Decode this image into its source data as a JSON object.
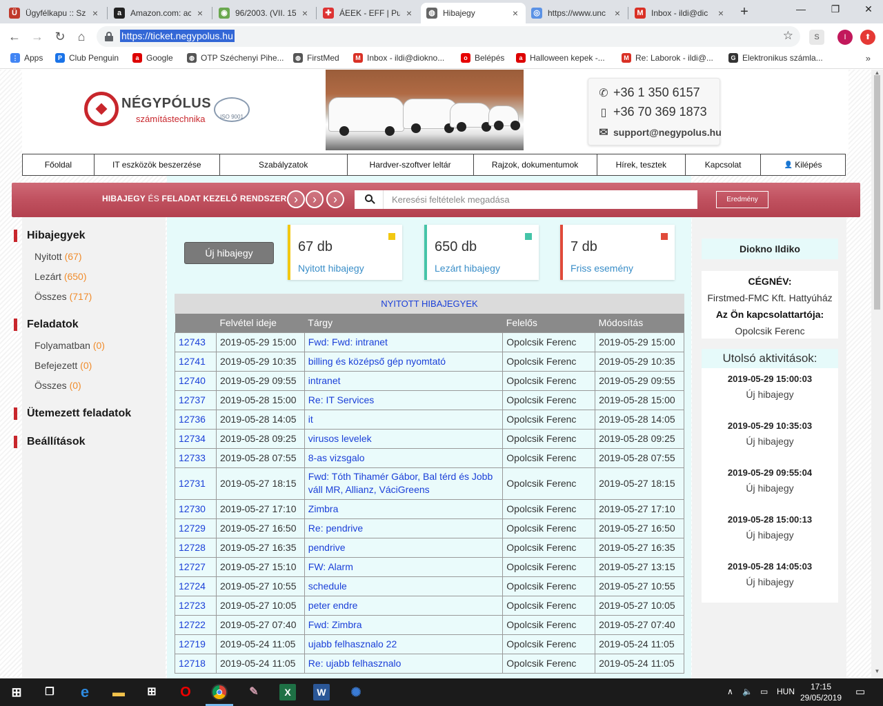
{
  "browser": {
    "tabs": [
      {
        "title": "Ügyfélkapu :: Sz",
        "icon": "ugyfelkapu-icon",
        "color": "#c0392b",
        "glyph": "Ü"
      },
      {
        "title": "Amazon.com: ac",
        "icon": "amazon-icon",
        "color": "#222",
        "glyph": "a"
      },
      {
        "title": "96/2003. (VII. 15",
        "icon": "globe-icon",
        "color": "#6aa84f",
        "glyph": "◉"
      },
      {
        "title": "ÁEEK - EFF | Pub",
        "icon": "aeek-icon",
        "color": "#d33",
        "glyph": "✚"
      },
      {
        "title": "Hibajegy",
        "icon": "globe-icon",
        "color": "#666",
        "glyph": "◍"
      },
      {
        "title": "https://www.unc",
        "icon": "un-icon",
        "color": "#5b92e5",
        "glyph": "◎"
      },
      {
        "title": "Inbox - ildi@dic",
        "icon": "gmail-icon",
        "color": "#d93025",
        "glyph": "M"
      }
    ],
    "url": "https://ticket.negypolus.hu",
    "profile_initial": "I",
    "bookmarks": [
      {
        "label": "Apps",
        "icon": "apps-grid-icon",
        "color": "#4285f4",
        "glyph": "⋮"
      },
      {
        "label": "Club Penguin",
        "icon": "penguin-icon",
        "color": "#1a73e8",
        "glyph": "P"
      },
      {
        "label": "Google",
        "icon": "ask-icon",
        "color": "#d00",
        "glyph": "a"
      },
      {
        "label": "OTP Széchenyi Pihe...",
        "icon": "globe-icon",
        "color": "#555",
        "glyph": "◍"
      },
      {
        "label": "FirstMed",
        "icon": "globe-icon",
        "color": "#555",
        "glyph": "◍"
      },
      {
        "label": "Inbox - ildi@diokno...",
        "icon": "gmail-icon",
        "color": "#d93025",
        "glyph": "M"
      },
      {
        "label": "Belépés",
        "icon": "vodafone-icon",
        "color": "#e60000",
        "glyph": "o"
      },
      {
        "label": "Halloween kepek -...",
        "icon": "ask-icon",
        "color": "#d00",
        "glyph": "a"
      },
      {
        "label": "Re: Laborok - ildi@...",
        "icon": "gmail-icon",
        "color": "#d93025",
        "glyph": "M"
      },
      {
        "label": "Elektronikus számla...",
        "icon": "g-icon",
        "color": "#333",
        "glyph": "G"
      }
    ]
  },
  "header": {
    "brand": "NÉGYPÓLUS",
    "brand_sub": "számítástechnika",
    "iso": "ISO 9001",
    "phone1": "+36 1 350 6157",
    "phone2": "+36 70 369 1873",
    "email": "support@negypolus.hu"
  },
  "menu": [
    {
      "label": "Főoldal"
    },
    {
      "label": "IT eszközök beszerzése"
    },
    {
      "label": "Szabályzatok"
    },
    {
      "label": "Hardver-szoftver leltár"
    },
    {
      "label": "Rajzok, dokumentumok"
    },
    {
      "label": "Hírek, tesztek"
    },
    {
      "label": "Kapcsolat"
    },
    {
      "label": "Kilépés"
    }
  ],
  "banner": {
    "title_part1": "HIBAJEGY",
    "title_part2": " ÉS ",
    "title_part3": "FELADAT KEZELŐ RENDSZER",
    "search_placeholder": "Keresési feltételek megadása",
    "result_button": "Eredmény"
  },
  "sidebar": {
    "tickets_title": "Hibajegyek",
    "tickets": [
      {
        "label": "Nyitott",
        "count": "(67)"
      },
      {
        "label": "Lezárt",
        "count": "(650)"
      },
      {
        "label": "Összes",
        "count": "(717)"
      }
    ],
    "tasks_title": "Feladatok",
    "tasks": [
      {
        "label": "Folyamatban",
        "count": "(0)"
      },
      {
        "label": "Befejezett",
        "count": "(0)"
      },
      {
        "label": "Összes",
        "count": "(0)"
      }
    ],
    "scheduled": "Ütemezett feladatok",
    "settings": "Beállítások"
  },
  "new_ticket_button": "Új hibajegy",
  "stats": [
    {
      "num": "67 db",
      "label": "Nyitott hibajegy",
      "color": "#f2c811"
    },
    {
      "num": "650 db",
      "label": "Lezárt hibajegy",
      "color": "#45c4a8"
    },
    {
      "num": "7 db",
      "label": "Friss esemény",
      "color": "#e04a3a"
    }
  ],
  "table": {
    "title": "NYITOTT HIBAJEGYEK",
    "headers": [
      "",
      "Felvétel ideje",
      "Tárgy",
      "Felelős",
      "Módosítás"
    ],
    "rows": [
      [
        "12743",
        "2019-05-29 15:00",
        "Fwd: Fwd: intranet",
        "Opolcsik Ferenc",
        "2019-05-29 15:00"
      ],
      [
        "12741",
        "2019-05-29 10:35",
        "billing és középső gép nyomtató",
        "Opolcsik Ferenc",
        "2019-05-29 10:35"
      ],
      [
        "12740",
        "2019-05-29 09:55",
        "intranet",
        "Opolcsik Ferenc",
        "2019-05-29 09:55"
      ],
      [
        "12737",
        "2019-05-28 15:00",
        "Re: IT Services",
        "Opolcsik Ferenc",
        "2019-05-28 15:00"
      ],
      [
        "12736",
        "2019-05-28 14:05",
        "it",
        "Opolcsik Ferenc",
        "2019-05-28 14:05"
      ],
      [
        "12734",
        "2019-05-28 09:25",
        "virusos levelek",
        "Opolcsik Ferenc",
        "2019-05-28 09:25"
      ],
      [
        "12733",
        "2019-05-28 07:55",
        "8-as vizsgalo",
        "Opolcsik Ferenc",
        "2019-05-28 07:55"
      ],
      [
        "12731",
        "2019-05-27 18:15",
        "Fwd: Tóth Tihamér Gábor, Bal térd és Jobb váll MR, Allianz, VáciGreens",
        "Opolcsik Ferenc",
        "2019-05-27 18:15"
      ],
      [
        "12730",
        "2019-05-27 17:10",
        "Zimbra",
        "Opolcsik Ferenc",
        "2019-05-27 17:10"
      ],
      [
        "12729",
        "2019-05-27 16:50",
        "Re: pendrive",
        "Opolcsik Ferenc",
        "2019-05-27 16:50"
      ],
      [
        "12728",
        "2019-05-27 16:35",
        "pendrive",
        "Opolcsik Ferenc",
        "2019-05-27 16:35"
      ],
      [
        "12727",
        "2019-05-27 15:10",
        "FW: Alarm",
        "Opolcsik Ferenc",
        "2019-05-27 13:15"
      ],
      [
        "12724",
        "2019-05-27 10:55",
        "schedule",
        "Opolcsik Ferenc",
        "2019-05-27 10:55"
      ],
      [
        "12723",
        "2019-05-27 10:05",
        "peter endre",
        "Opolcsik Ferenc",
        "2019-05-27 10:05"
      ],
      [
        "12722",
        "2019-05-27 07:40",
        "Fwd: Zimbra",
        "Opolcsik Ferenc",
        "2019-05-27 07:40"
      ],
      [
        "12719",
        "2019-05-24 11:05",
        "ujabb felhasznalo 22",
        "Opolcsik Ferenc",
        "2019-05-24 11:05"
      ],
      [
        "12718",
        "2019-05-24 11:05",
        "Re: ujabb felhasznalo",
        "Opolcsik Ferenc",
        "2019-05-24 11:05"
      ]
    ]
  },
  "right": {
    "user_name": "Diokno Ildiko",
    "company_label": "CÉGNÉV:",
    "company_name": "Firstmed-FMC Kft. Hattyúház",
    "contact_label": "Az Ön kapcsolattartója:",
    "contact_name": "Opolcsik Ferenc",
    "activity_title": "Utolsó aktivitások:",
    "activities": [
      {
        "time": "2019-05-29 15:00:03",
        "desc": "Új hibajegy"
      },
      {
        "time": "2019-05-29 10:35:03",
        "desc": "Új hibajegy"
      },
      {
        "time": "2019-05-29 09:55:04",
        "desc": "Új hibajegy"
      },
      {
        "time": "2019-05-28 15:00:13",
        "desc": "Új hibajegy"
      },
      {
        "time": "2019-05-28 14:05:03",
        "desc": "Új hibajegy"
      }
    ]
  },
  "taskbar": {
    "language": "HUN",
    "time": "17:15",
    "date": "29/05/2019"
  }
}
